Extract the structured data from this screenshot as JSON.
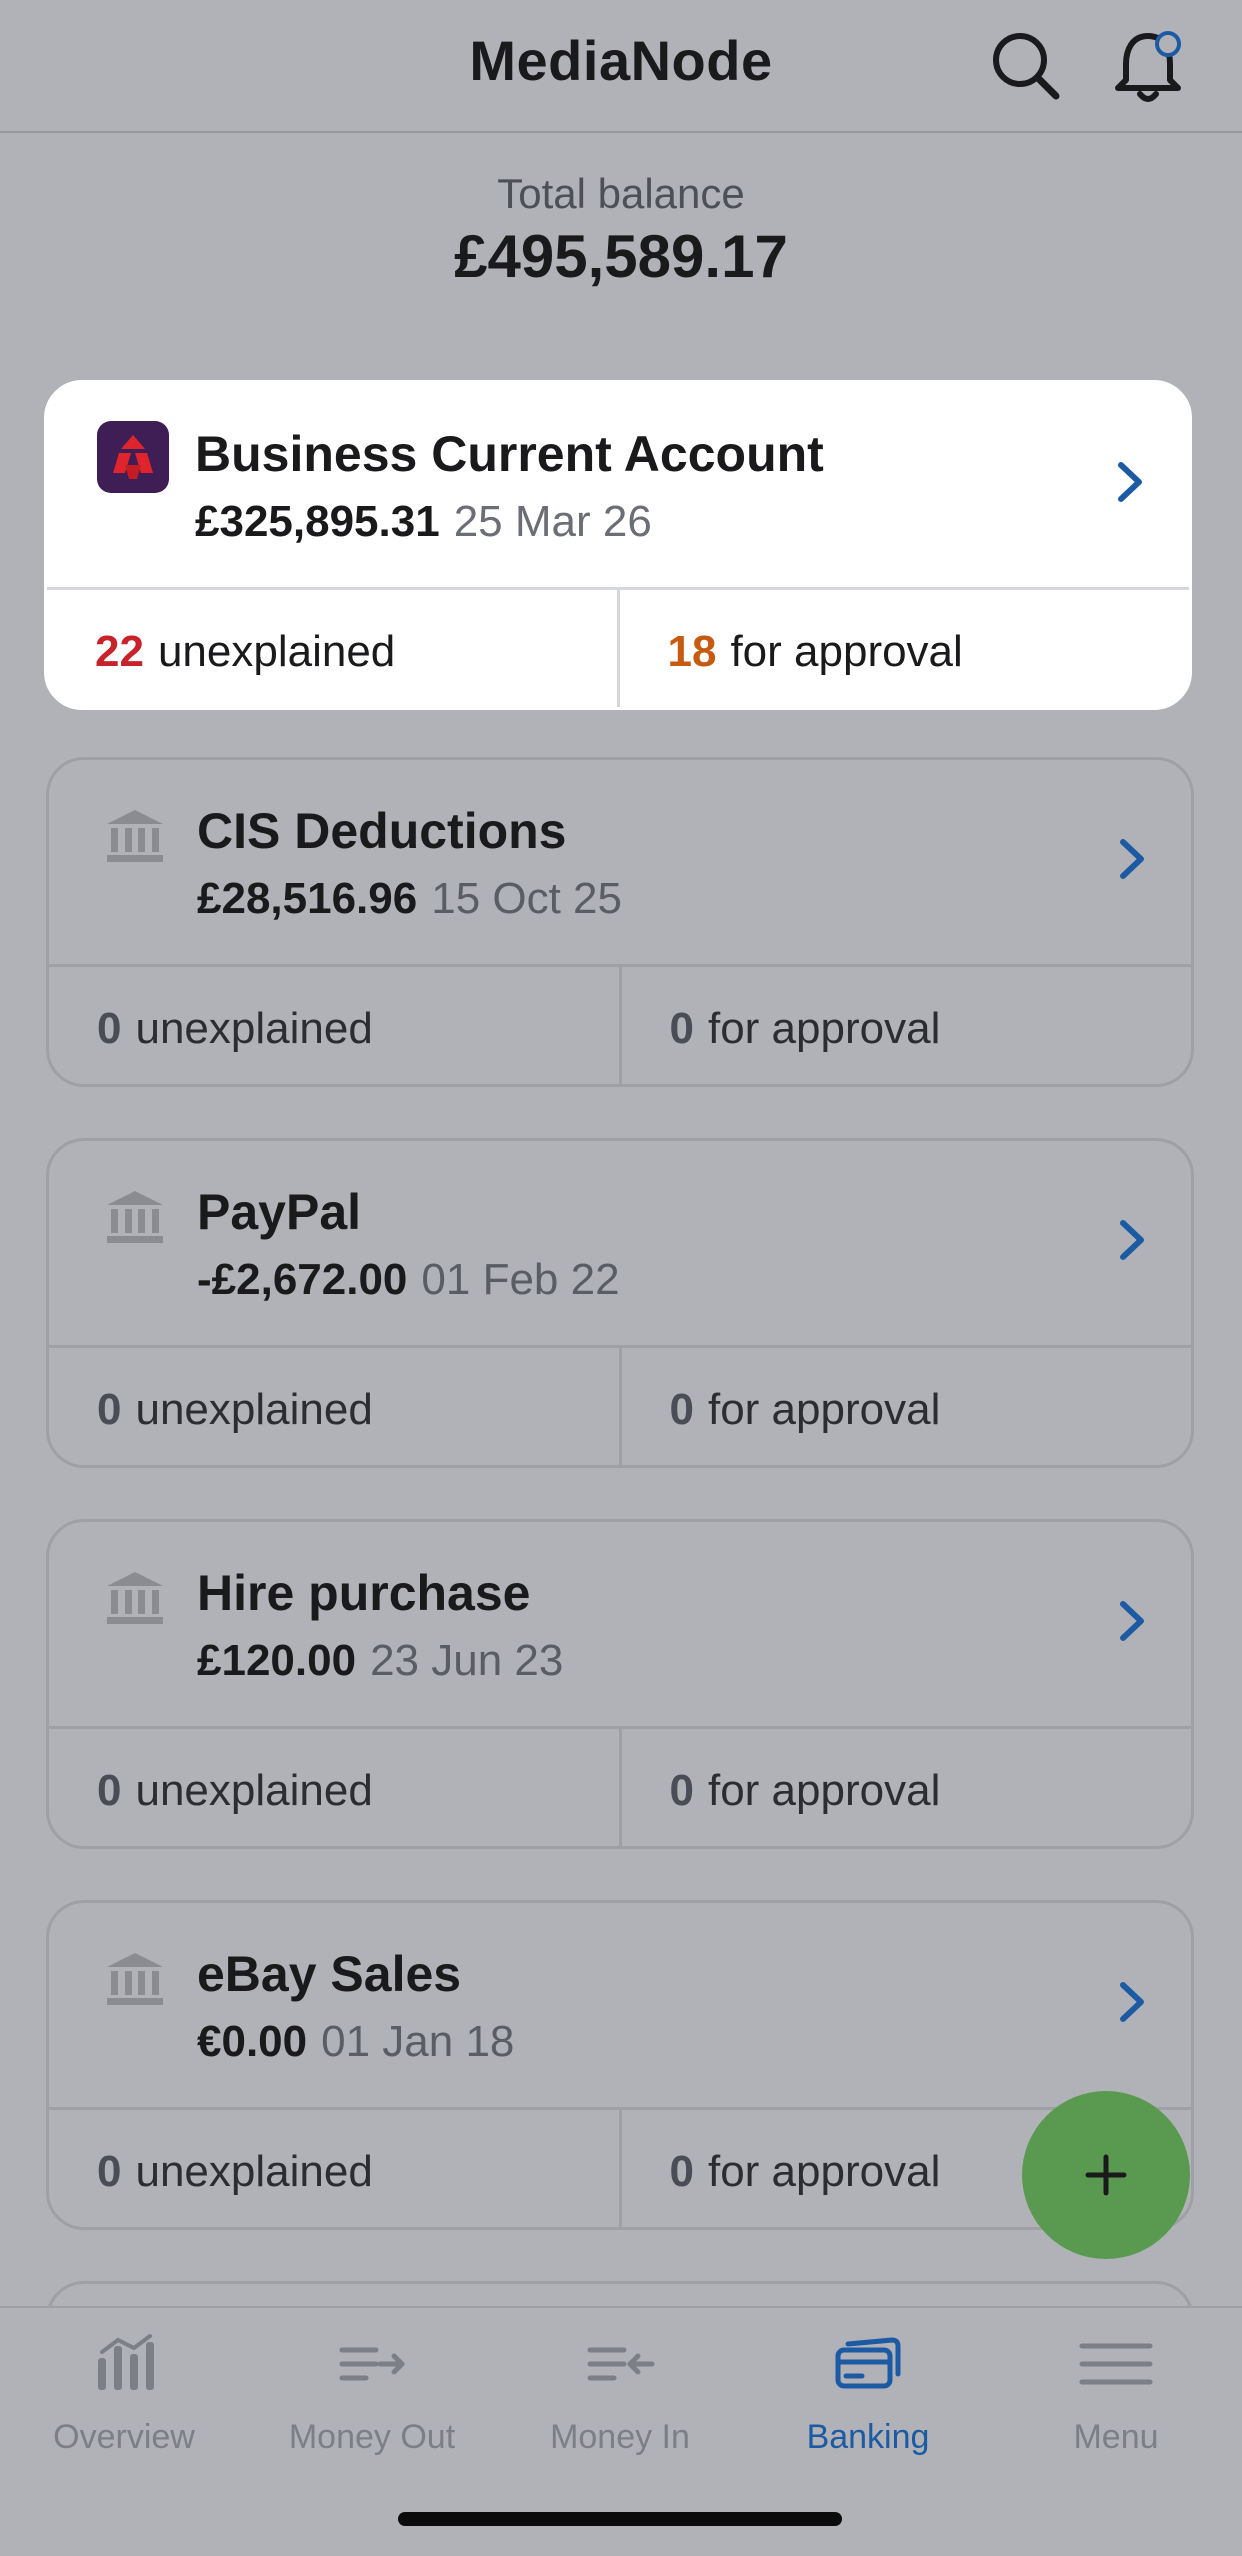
{
  "header": {
    "title": "MediaNode",
    "search_icon": "search-icon",
    "bell_icon": "bell-icon"
  },
  "total": {
    "label": "Total balance",
    "value": "£495,589.17"
  },
  "accounts": [
    {
      "name": "Business Current Account",
      "balance": "£325,895.31",
      "date": "25 Mar 26",
      "unexplained_count": "22",
      "unexplained_label": "unexplained",
      "approval_count": "18",
      "approval_label": "for approval",
      "icon": "natwest-logo"
    },
    {
      "name": "CIS Deductions",
      "balance": "£28,516.96",
      "date": "15 Oct 25",
      "unexplained_count": "0",
      "unexplained_label": "unexplained",
      "approval_count": "0",
      "approval_label": "for approval",
      "icon": "bank-icon"
    },
    {
      "name": "PayPal",
      "balance": "-£2,672.00",
      "date": "01 Feb 22",
      "unexplained_count": "0",
      "unexplained_label": "unexplained",
      "approval_count": "0",
      "approval_label": "for approval",
      "icon": "bank-icon"
    },
    {
      "name": "Hire purchase",
      "balance": "£120.00",
      "date": "23 Jun 23",
      "unexplained_count": "0",
      "unexplained_label": "unexplained",
      "approval_count": "0",
      "approval_label": "for approval",
      "icon": "bank-icon"
    },
    {
      "name": "eBay Sales",
      "balance": "€0.00",
      "date": "01 Jan 18",
      "unexplained_count": "0",
      "unexplained_label": "unexplained",
      "approval_count": "0",
      "approval_label": "for approval",
      "icon": "bank-icon"
    }
  ],
  "fab": {
    "icon": "plus-icon"
  },
  "nav": {
    "items": [
      {
        "label": "Overview",
        "icon": "overview-icon",
        "active": false
      },
      {
        "label": "Money Out",
        "icon": "money-out-icon",
        "active": false
      },
      {
        "label": "Money In",
        "icon": "money-in-icon",
        "active": false
      },
      {
        "label": "Banking",
        "icon": "banking-icon",
        "active": true
      },
      {
        "label": "Menu",
        "icon": "menu-icon",
        "active": false
      }
    ]
  },
  "colors": {
    "accent_blue": "#1c5aa3",
    "unexplained_red": "#c8232b",
    "approval_orange": "#c65a10",
    "fab_green": "#5a9a50",
    "overlay_grey": "#b1b2b7"
  }
}
